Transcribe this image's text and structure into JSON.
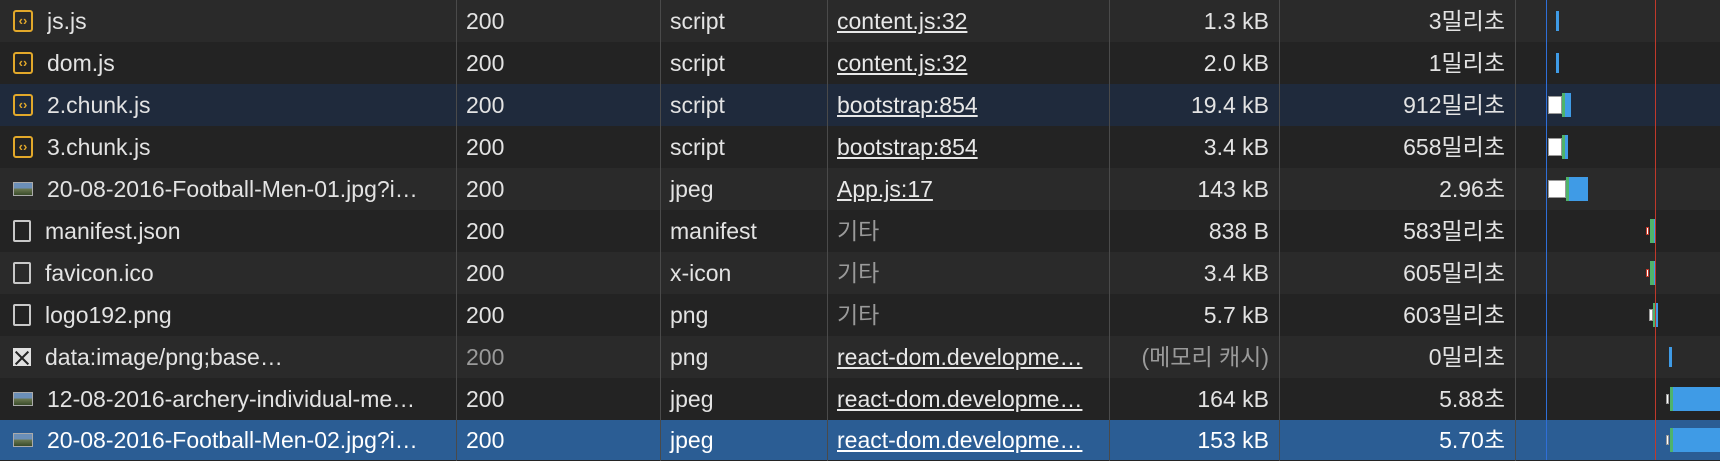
{
  "columns_hint": [
    "name",
    "status",
    "type",
    "initiator",
    "size",
    "time",
    "waterfall"
  ],
  "rows": [
    {
      "name": "js.js",
      "icon": "script-icon",
      "status": "200",
      "type": "script",
      "initiator": "content.js:32",
      "size": "1.3 kB",
      "time": "3밀리초"
    },
    {
      "name": "dom.js",
      "icon": "script-icon",
      "status": "200",
      "type": "script",
      "initiator": "content.js:32",
      "size": "2.0 kB",
      "time": "1밀리초"
    },
    {
      "name": "2.chunk.js",
      "icon": "script-icon",
      "status": "200",
      "type": "script",
      "initiator": "bootstrap:854",
      "size": "19.4 kB",
      "time": "912밀리초"
    },
    {
      "name": "3.chunk.js",
      "icon": "script-icon",
      "status": "200",
      "type": "script",
      "initiator": "bootstrap:854",
      "size": "3.4 kB",
      "time": "658밀리초"
    },
    {
      "name": "20-08-2016-Football-Men-01.jpg?i…",
      "icon": "image-icon",
      "status": "200",
      "type": "jpeg",
      "initiator": "App.js:17",
      "size": "143 kB",
      "time": "2.96초"
    },
    {
      "name": "manifest.json",
      "icon": "document-icon",
      "status": "200",
      "type": "manifest",
      "initiator": "기타",
      "size": "838 B",
      "time": "583밀리초"
    },
    {
      "name": "favicon.ico",
      "icon": "document-icon",
      "status": "200",
      "type": "x-icon",
      "initiator": "기타",
      "size": "3.4 kB",
      "time": "605밀리초"
    },
    {
      "name": "logo192.png",
      "icon": "document-icon",
      "status": "200",
      "type": "png",
      "initiator": "기타",
      "size": "5.7 kB",
      "time": "603밀리초"
    },
    {
      "name": "data:image/png;base…",
      "icon": "broken-image-icon",
      "status": "200",
      "type": "png",
      "initiator": "react-dom.developme…",
      "size": "(메모리 캐시)",
      "time": "0밀리초"
    },
    {
      "name": "12-08-2016-archery-individual-me…",
      "icon": "image-icon",
      "status": "200",
      "type": "jpeg",
      "initiator": "react-dom.developme…",
      "size": "164 kB",
      "time": "5.88초"
    },
    {
      "name": "20-08-2016-Football-Men-02.jpg?i…",
      "icon": "image-icon",
      "status": "200",
      "type": "jpeg",
      "initiator": "react-dom.developme…",
      "size": "153 kB",
      "time": "5.70초"
    }
  ],
  "colors": {
    "selected_row": "#2b5d94",
    "hover_row": "#1f2a3c",
    "dom_content_loaded_line": "#2f6fd8",
    "load_line": "#c0392b",
    "script_icon": "#e2a82a"
  }
}
